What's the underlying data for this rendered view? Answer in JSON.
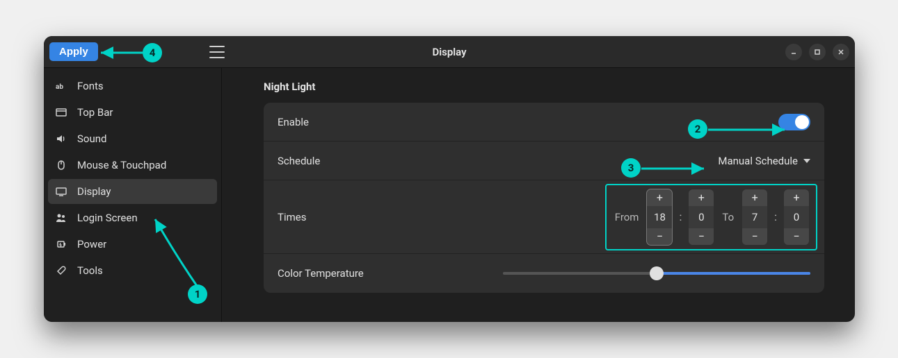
{
  "titlebar": {
    "apply_label": "Apply",
    "title": "Display"
  },
  "sidebar": {
    "items": [
      {
        "label": "Fonts",
        "icon": "fonts-icon"
      },
      {
        "label": "Top Bar",
        "icon": "topbar-icon"
      },
      {
        "label": "Sound",
        "icon": "sound-icon"
      },
      {
        "label": "Mouse & Touchpad",
        "icon": "mouse-icon"
      },
      {
        "label": "Display",
        "icon": "display-icon"
      },
      {
        "label": "Login Screen",
        "icon": "login-icon"
      },
      {
        "label": "Power",
        "icon": "power-icon"
      },
      {
        "label": "Tools",
        "icon": "tools-icon"
      }
    ],
    "active_index": 4
  },
  "section": {
    "title": "Night Light",
    "enable_label": "Enable",
    "enable_value": true,
    "schedule_label": "Schedule",
    "schedule_value": "Manual Schedule",
    "times_label": "Times",
    "times": {
      "from_label": "From",
      "from_hour": "18",
      "from_minute": "0",
      "to_label": "To",
      "to_hour": "7",
      "to_minute": "0"
    },
    "temp_label": "Color Temperature",
    "temp_value_pct": 50
  },
  "annotations": {
    "1": "Display sidebar item",
    "2": "Enable toggle",
    "3": "Schedule dropdown",
    "4": "Apply button"
  }
}
